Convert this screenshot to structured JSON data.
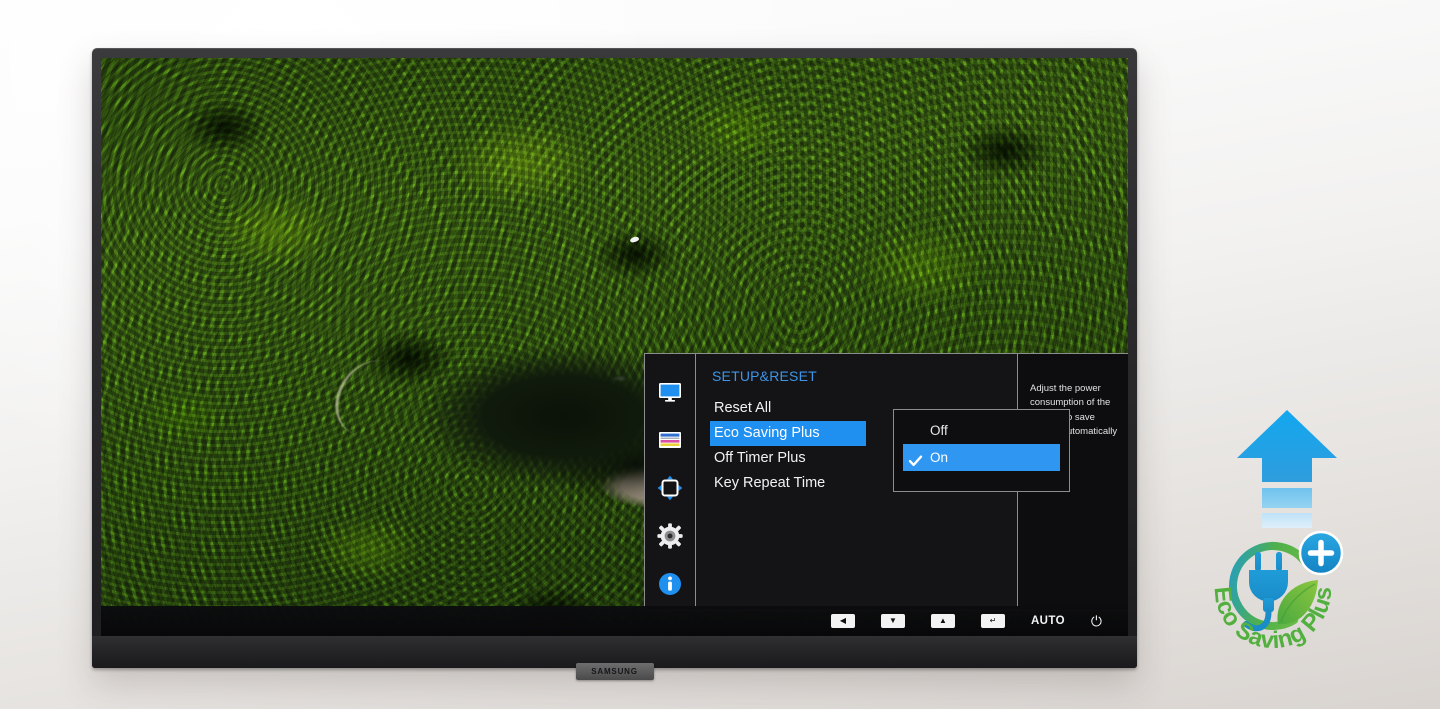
{
  "page": {
    "title": "Samsung monitor Eco Saving Plus feature",
    "brand": "SAMSUNG"
  },
  "screen_image": {
    "name": "aerial-rainforest-river-photo",
    "description": "Aerial view of dense green rainforest canopy with a dark winding river and sandy bank"
  },
  "osd": {
    "sidebar": [
      {
        "icon": "monitor-icon",
        "label": "Picture"
      },
      {
        "icon": "color-bars-icon",
        "label": "Color"
      },
      {
        "icon": "screen-adjust-icon",
        "label": "Display"
      },
      {
        "icon": "gear-icon",
        "label": "Setup and Reset"
      },
      {
        "icon": "info-icon",
        "label": "Information"
      }
    ],
    "selected_sidebar_index": 3,
    "title": "SETUP&RESET",
    "menu_items": [
      {
        "label": "Reset All",
        "selected": false
      },
      {
        "label": "Eco Saving Plus",
        "selected": true
      },
      {
        "label": "Off Timer Plus",
        "selected": false
      },
      {
        "label": "Key Repeat Time",
        "selected": false
      }
    ],
    "submenu": {
      "options": [
        {
          "label": "Off",
          "selected": false,
          "checked": false
        },
        {
          "label": "On",
          "selected": true,
          "checked": true
        }
      ]
    },
    "help_text": "Adjust the power consumption of the product to save energy automatically",
    "colors": {
      "highlight": "#1f8ff0",
      "submenu_highlight": "#2f96f2",
      "title": "#3d95e8",
      "panel_bg": "#141416",
      "panel_border": "#8d8d90"
    }
  },
  "button_bar": {
    "keys": [
      {
        "name": "left-arrow-key",
        "glyph": "◀",
        "label": "Left"
      },
      {
        "name": "down-arrow-key",
        "glyph": "▼",
        "label": "Down"
      },
      {
        "name": "up-arrow-key",
        "glyph": "▲",
        "label": "Up"
      },
      {
        "name": "enter-key",
        "glyph": "↵",
        "label": "Enter"
      }
    ],
    "auto_label": "AUTO",
    "power_glyph": "⏻"
  },
  "eco_graphic": {
    "arrow": {
      "name": "upward-arrow",
      "color_top": "#1aa3ec",
      "color_bottom": "#2e9fe0"
    },
    "logo": {
      "name": "eco-saving-plus-logo",
      "text": "Eco Saving Plus",
      "plus_badge": "+",
      "colors": {
        "green": "#62b844",
        "blue": "#1e9ad6",
        "leaf": "#74c043"
      }
    }
  }
}
